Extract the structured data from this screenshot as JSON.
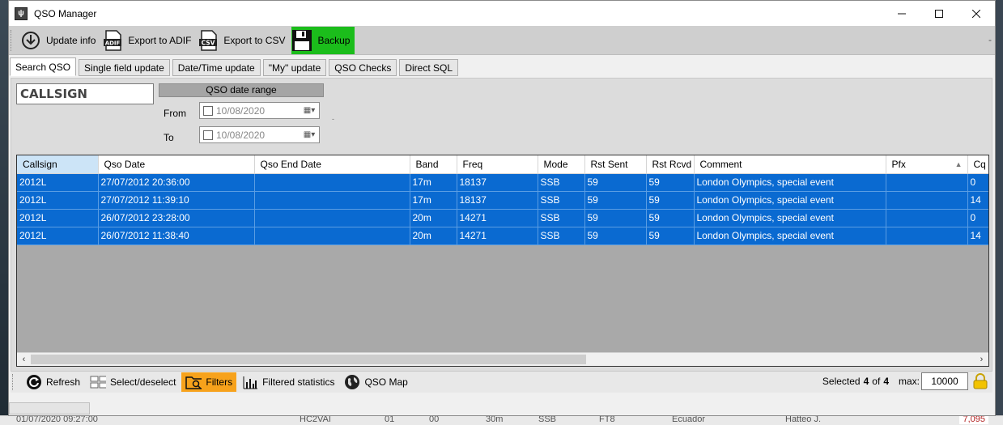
{
  "window": {
    "title": "QSO Manager"
  },
  "toolbar": {
    "update_info": "Update info",
    "export_adif": "Export to ADIF",
    "export_csv": "Export to CSV",
    "backup": "Backup",
    "adif_icon_text": "ADIF",
    "csv_icon_text": "CSV"
  },
  "tabs": [
    "Search QSO",
    "Single field update",
    "Date/Time update",
    "\"My\" update",
    "QSO Checks",
    "Direct SQL"
  ],
  "search": {
    "callsign_placeholder": "CALLSIGN",
    "date_range_label": "QSO date range",
    "from_label": "From",
    "to_label": "To",
    "from_date": "10/08/2020",
    "to_date": "10/08/2020"
  },
  "table": {
    "columns": [
      "Callsign",
      "Qso Date",
      "Qso End Date",
      "Band",
      "Freq",
      "Mode",
      "Rst Sent",
      "Rst Rcvd",
      "Comment",
      "Pfx",
      "Cq"
    ],
    "rows": [
      [
        "2012L",
        "27/07/2012 20:36:00",
        "",
        "17m",
        "18137",
        "SSB",
        "59",
        "59",
        "London Olympics, special event",
        "",
        "0"
      ],
      [
        "2012L",
        "27/07/2012 11:39:10",
        "",
        "17m",
        "18137",
        "SSB",
        "59",
        "59",
        "London Olympics, special event",
        "",
        "14"
      ],
      [
        "2012L",
        "26/07/2012 23:28:00",
        "",
        "20m",
        "14271",
        "SSB",
        "59",
        "59",
        "London Olympics, special event",
        "",
        "0"
      ],
      [
        "2012L",
        "26/07/2012 11:38:40",
        "",
        "20m",
        "14271",
        "SSB",
        "59",
        "59",
        "London Olympics, special event",
        "",
        "14"
      ]
    ]
  },
  "bottom": {
    "refresh": "Refresh",
    "select_deselect": "Select/deselect",
    "filters": "Filters",
    "filtered_statistics": "Filtered statistics",
    "qso_map": "QSO Map",
    "selected_label": "Selected",
    "selected_count": "4",
    "of_label": "of",
    "total_count": "4",
    "max_label": "max:",
    "max_value": "10000"
  },
  "background": {
    "frag_date": "01/07/2020 09:27:00",
    "frag_call": "HC2VAI",
    "frag_n1": "01",
    "frag_n2": "00",
    "frag_band": "30m",
    "frag_mode": "SSB",
    "frag_prop": "FT8",
    "frag_country": "Ecuador",
    "frag_name": "Hatteo J.",
    "frag_value": "7,095"
  },
  "colors": {
    "selection": "#0a6ad1",
    "backup_active": "#1bbd1b",
    "filters_active": "#f7a21b"
  }
}
